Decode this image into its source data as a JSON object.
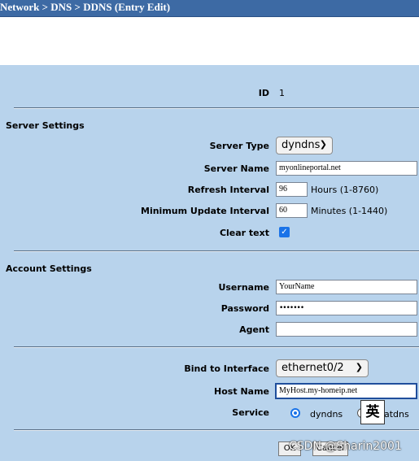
{
  "breadcrumb": "Network > DNS > DDNS (Entry Edit)",
  "id": {
    "label": "ID",
    "value": "1"
  },
  "server_settings": {
    "heading": "Server Settings",
    "server_type": {
      "label": "Server Type",
      "value": "dyndns"
    },
    "server_name": {
      "label": "Server Name",
      "value": "myonlineportal.net"
    },
    "refresh_interval": {
      "label": "Refresh Interval",
      "value": "96",
      "unit": "Hours (1-8760)"
    },
    "min_update_interval": {
      "label": "Minimum Update Interval",
      "value": "60",
      "unit": "Minutes (1-1440)"
    },
    "clear_text": {
      "label": "Clear text",
      "checked": true
    }
  },
  "account_settings": {
    "heading": "Account Settings",
    "username": {
      "label": "Username",
      "value": "YourName"
    },
    "password": {
      "label": "Password",
      "value": "•••••••"
    },
    "agent": {
      "label": "Agent",
      "value": ""
    }
  },
  "interface_settings": {
    "bind_interface": {
      "label": "Bind to Interface",
      "value": "ethernet0/2"
    },
    "host_name": {
      "label": "Host Name",
      "value": "MyHost.my-homeip.net"
    },
    "service": {
      "label": "Service",
      "option1": "dyndns",
      "option2": "atdns"
    }
  },
  "ime_indicator": "英",
  "buttons": {
    "ok": "OK",
    "cancel": "Cancel"
  },
  "watermark": "CSDN @Sharin2001"
}
